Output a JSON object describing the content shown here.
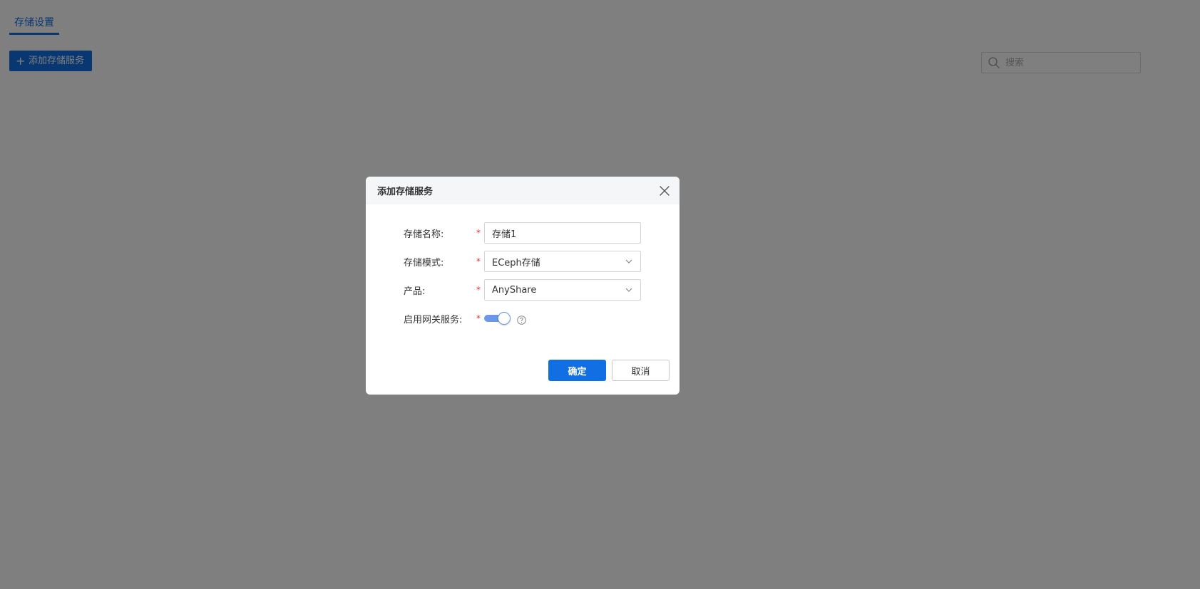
{
  "page": {
    "tab_label": "存储设置",
    "add_button_label": "添加存储服务",
    "search": {
      "placeholder": "搜索",
      "value": ""
    }
  },
  "modal": {
    "title": "添加存储服务",
    "fields": [
      {
        "label": "存储名称:",
        "required": "*",
        "value": "存储1",
        "kind": "text"
      },
      {
        "label": "存储模式:",
        "required": "*",
        "value": "ECeph存储",
        "kind": "select"
      },
      {
        "label": "产品:",
        "required": "*",
        "value": "AnyShare",
        "kind": "select"
      },
      {
        "label": "启用网关服务:",
        "required": "*",
        "kind": "switch",
        "on": true
      }
    ],
    "ok_label": "确定",
    "cancel_label": "取消"
  },
  "colors": {
    "primary": "#126ee3",
    "overlay": "rgba(0,0,0,0.5)",
    "required": "#e5312e",
    "switch_on": "#6c97e8"
  },
  "icons": [
    "plus-icon",
    "search-icon",
    "close-icon",
    "chevron-down-icon",
    "help-icon"
  ]
}
